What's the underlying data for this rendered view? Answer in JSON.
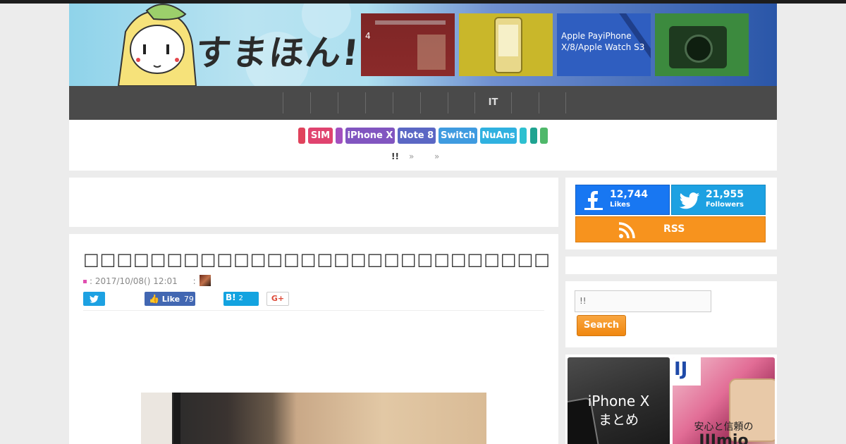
{
  "header": {
    "logo_text": "すまほん!!",
    "featured": [
      {
        "caption": "4",
        "color": "#8b2a2a"
      },
      {
        "caption": "",
        "color": "#c9b72a"
      },
      {
        "caption": "Apple PayiPhone X/8/Apple Watch S3",
        "color": "#2f5ec0"
      },
      {
        "caption": "",
        "color": "#3c8a3e"
      }
    ]
  },
  "nav": {
    "items": [
      "",
      "",
      "",
      "",
      "",
      "",
      "IT",
      "",
      ""
    ]
  },
  "tags": [
    {
      "label": "",
      "color": "#e0435c"
    },
    {
      "label": "SIM",
      "color": "#e0436f"
    },
    {
      "label": "",
      "color": "#a24fbf"
    },
    {
      "label": "iPhone X",
      "color": "#8155c0"
    },
    {
      "label": "Note 8",
      "color": "#5b67c4"
    },
    {
      "label": "Switch",
      "color": "#3f9be0"
    },
    {
      "label": "NuAns",
      "color": "#2fb1e0"
    },
    {
      "label": "",
      "color": "#2ec0d0"
    },
    {
      "label": "",
      "color": "#1fa391"
    },
    {
      "label": "",
      "color": "#4fb86a"
    }
  ],
  "breadcrumb": {
    "home": "!!",
    "sep1": "»",
    "sep2": "»"
  },
  "article": {
    "title": "□□□□□□□□□□□□□□□□□□□□□□□□□□□□□□□□□□□□",
    "date_label": ": 2017/10/08() 12:01",
    "author_sep": ":",
    "share": {
      "fb_like_label": "Like",
      "fb_like_count": "79",
      "hatena_label": "B!",
      "hatena_count": "2",
      "gplus_label": "G+"
    }
  },
  "sidebar": {
    "facebook": {
      "count": "12,744",
      "label": "Likes"
    },
    "twitter": {
      "count": "21,955",
      "label": "Followers"
    },
    "rss_label": "RSS",
    "search": {
      "value": "!!",
      "button_label": "Search"
    },
    "banners": [
      {
        "line1": "iPhone X",
        "line2": "まとめ"
      },
      {
        "line1": "安心と信頼の",
        "line2": "IIJmio"
      }
    ]
  },
  "colors": {
    "facebook": "#1877f2",
    "twitter": "#1da1e2",
    "rss": "#f7931e",
    "nav_bg": "#4a4a4a"
  }
}
